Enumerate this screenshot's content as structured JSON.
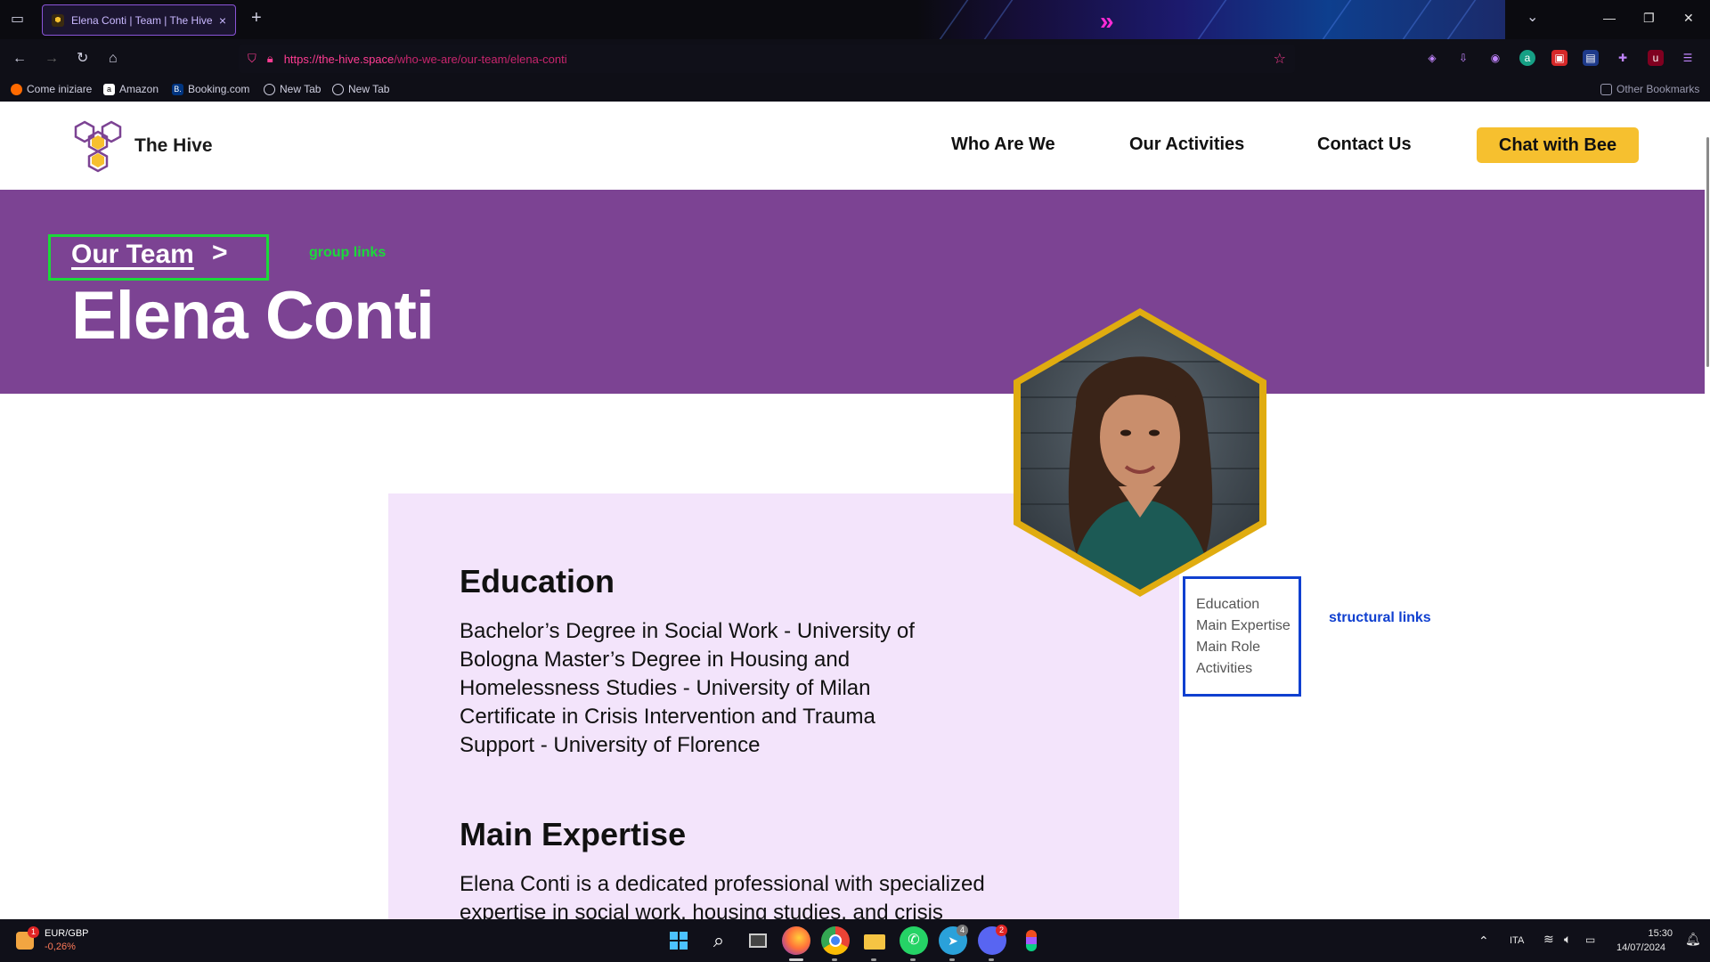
{
  "browser": {
    "tab_title": "Elena Conti | Team | The Hive",
    "tab_close": "×",
    "new_tab": "+",
    "url_domain": "https://the-hive.space",
    "url_path": "/who-we-are/our-team/elena-conti",
    "bookmarks": [
      {
        "label": "Come iniziare",
        "icon": "firefox-icon"
      },
      {
        "label": "Amazon",
        "icon": "amazon-icon"
      },
      {
        "label": "Booking.com",
        "icon": "booking-icon"
      },
      {
        "label": "New Tab",
        "icon": "globe-icon"
      },
      {
        "label": "New Tab",
        "icon": "globe-icon"
      }
    ],
    "other_bookmarks": "Other Bookmarks"
  },
  "site": {
    "brand": "The Hive",
    "nav": [
      "Who Are We",
      "Our Activities",
      "Contact Us"
    ],
    "cta": "Chat with Bee",
    "colors": {
      "purple": "#7c4393",
      "yellow": "#f6c02f",
      "card": "#f3e4fb"
    }
  },
  "hero": {
    "breadcrumb": "Our Team",
    "breadcrumb_chevron": ">",
    "group_links_label": "group links",
    "name": "Elena Conti"
  },
  "content": {
    "education_title": "Education",
    "education_lines": [
      "Bachelor’s Degree in Social Work - University of",
      "Bologna Master’s Degree in Housing and",
      "Homelessness Studies - University of Milan",
      "Certificate in Crisis Intervention and Trauma",
      "Support - University of Florence"
    ],
    "expertise_title": "Main Expertise",
    "expertise_lines": [
      "Elena Conti is a dedicated professional with specialized",
      "expertise in social work, housing studies, and crisis"
    ]
  },
  "toc": {
    "items": [
      "Education",
      "Main Expertise",
      "Main Role",
      "Activities"
    ],
    "label": "structural links"
  },
  "taskbar": {
    "ticker_name": "EUR/GBP",
    "ticker_change": "-0,26%",
    "ticker_badge": "1",
    "lang": "ITA",
    "time": "15:30",
    "date": "14/07/2024",
    "telegram_badge": "4",
    "discord_badge": "2"
  }
}
